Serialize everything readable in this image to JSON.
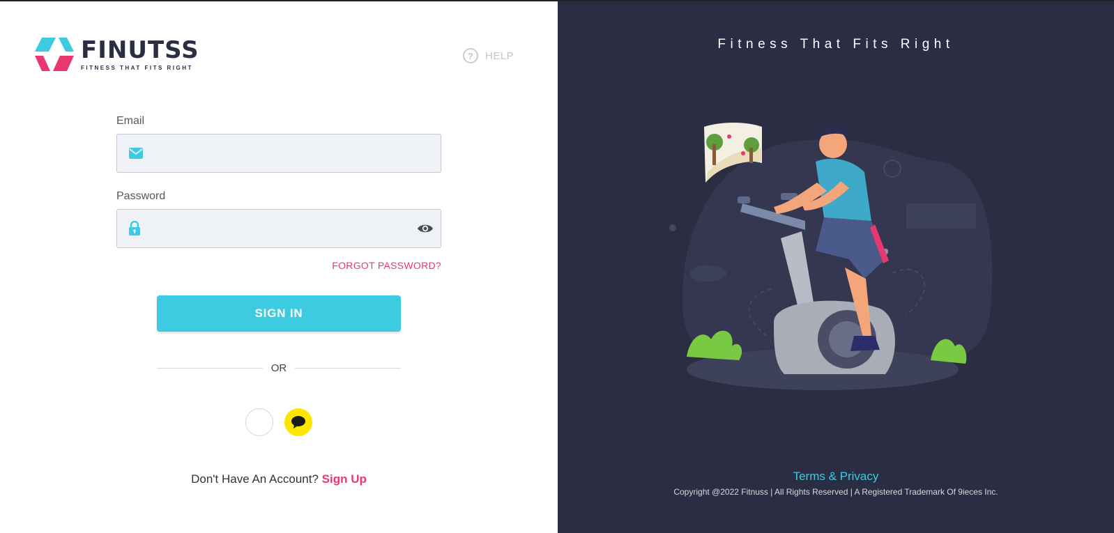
{
  "brand": {
    "name": "FINUTSS",
    "tagline": "FITNESS THAT FITS RIGHT"
  },
  "header": {
    "help_label": "HELP"
  },
  "form": {
    "email_label": "Email",
    "email_value": "",
    "password_label": "Password",
    "password_value": "",
    "forgot_label": "FORGOT PASSWORD?",
    "signin_label": "SIGN IN",
    "or_label": "OR",
    "signup_prompt": "Don't Have An Account?",
    "signup_label": "Sign Up"
  },
  "social": {
    "icons": [
      "blank-circle-icon",
      "kakao-chat-icon"
    ]
  },
  "aside": {
    "slogan": "Fitness That Fits Right",
    "terms_label": "Terms & Privacy",
    "copyright": "Copyright @2022 Fitnuss | All Rights Reserved | A Registered Trademark Of 9ieces Inc."
  },
  "colors": {
    "accent_cyan": "#3ccbe0",
    "accent_pink": "#e8386f",
    "dark_panel": "#2b2d42",
    "kakao_yellow": "#fee500"
  }
}
